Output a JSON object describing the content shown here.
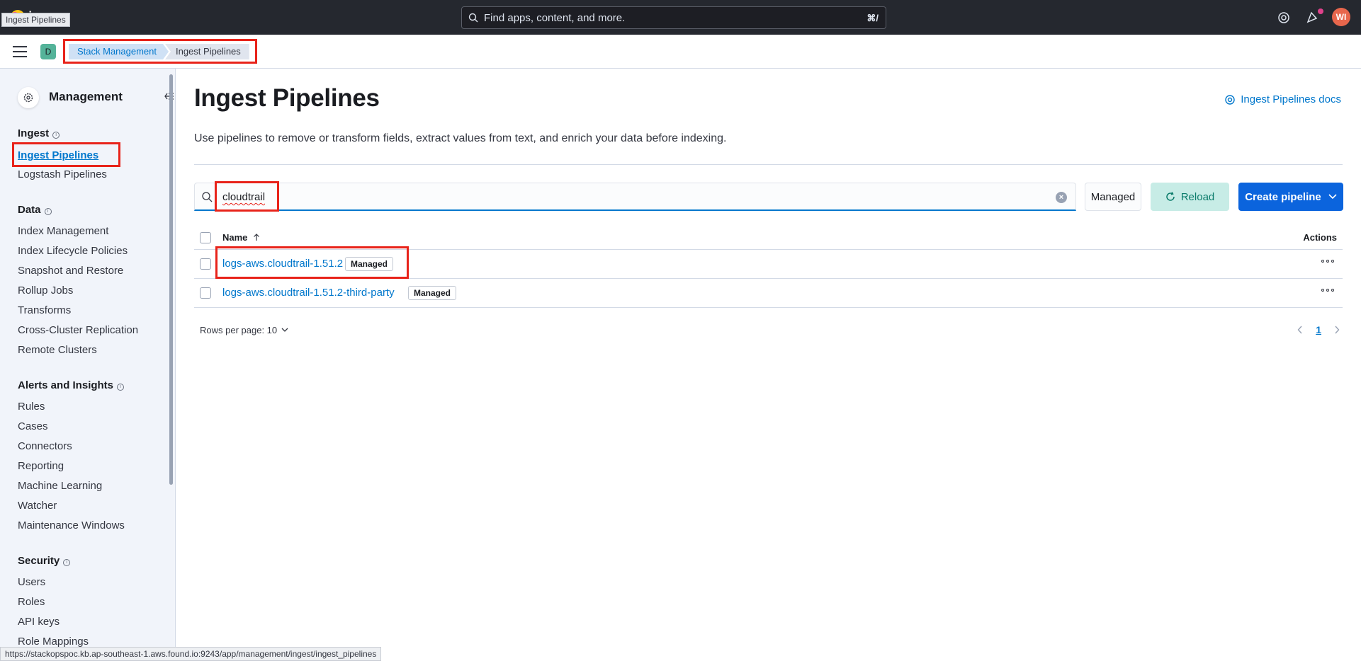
{
  "header": {
    "logo_text": "ic",
    "tooltip": "Ingest Pipelines",
    "search_placeholder": "Find apps, content, and more.",
    "search_shortcut": "⌘/",
    "avatar_initials": "WI"
  },
  "subbar": {
    "space_initial": "D",
    "breadcrumbs": [
      "Stack Management",
      "Ingest Pipelines"
    ]
  },
  "sidebar": {
    "title": "Management",
    "sections": [
      {
        "title": "Ingest",
        "items": [
          "Ingest Pipelines",
          "Logstash Pipelines"
        ]
      },
      {
        "title": "Data",
        "items": [
          "Index Management",
          "Index Lifecycle Policies",
          "Snapshot and Restore",
          "Rollup Jobs",
          "Transforms",
          "Cross-Cluster Replication",
          "Remote Clusters"
        ]
      },
      {
        "title": "Alerts and Insights",
        "items": [
          "Rules",
          "Cases",
          "Connectors",
          "Reporting",
          "Machine Learning",
          "Watcher",
          "Maintenance Windows"
        ]
      },
      {
        "title": "Security",
        "items": [
          "Users",
          "Roles",
          "API keys",
          "Role Mappings"
        ]
      }
    ],
    "active_item": "Ingest Pipelines"
  },
  "main": {
    "title": "Ingest Pipelines",
    "docs_link": "Ingest Pipelines docs",
    "description": "Use pipelines to remove or transform fields, extract values from text, and enrich your data before indexing.",
    "search_value": "cloudtrail",
    "managed_filter": "Managed",
    "reload_label": "Reload",
    "create_label": "Create pipeline",
    "table": {
      "col_name": "Name",
      "col_actions": "Actions",
      "rows": [
        {
          "name": "logs-aws.cloudtrail-1.51.2",
          "badge": "Managed"
        },
        {
          "name": "logs-aws.cloudtrail-1.51.2-third-party",
          "badge": "Managed"
        }
      ]
    },
    "rows_per_page": "Rows per page: 10",
    "current_page": "1"
  },
  "status_url": "https://stackopspoc.kb.ap-southeast-1.aws.found.io:9243/app/management/ingest/ingest_pipelines",
  "colors": {
    "accent": "#0077cc",
    "primary_button": "#0b64dd",
    "highlight": "#e8231a",
    "header_bg": "#25282f"
  }
}
